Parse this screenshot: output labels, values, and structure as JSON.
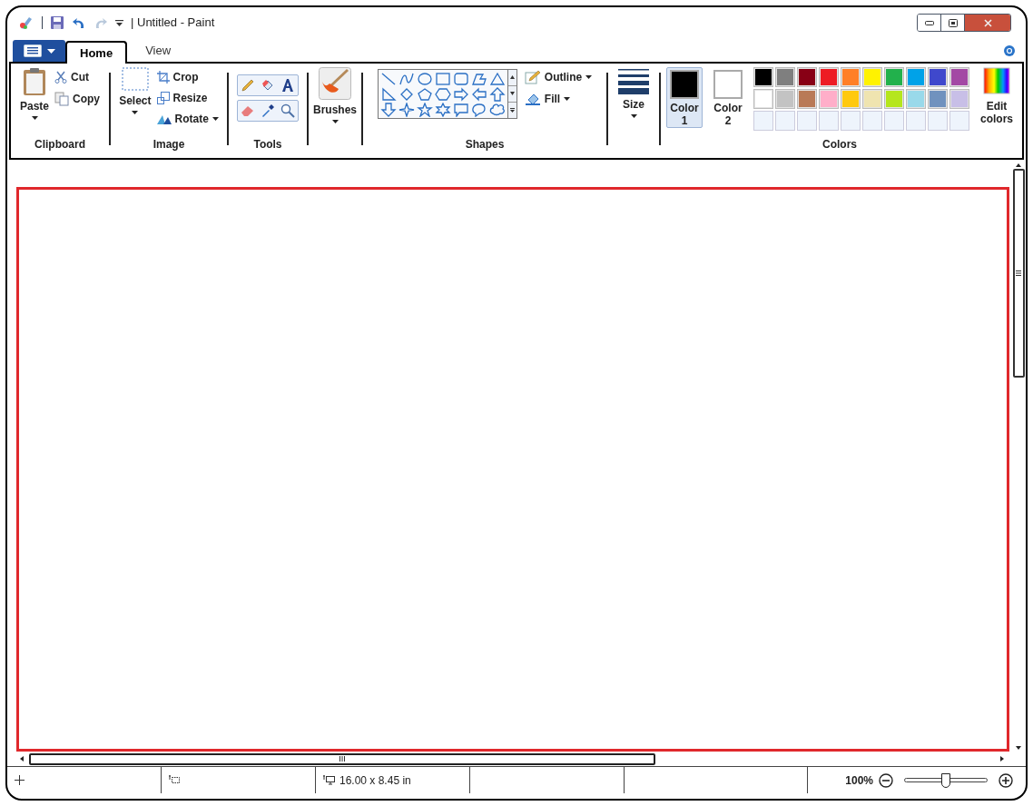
{
  "window": {
    "title": "| Untitled - Paint"
  },
  "tabs": [
    {
      "label": "Home",
      "selected": true
    },
    {
      "label": "View",
      "selected": false
    }
  ],
  "ribbon": {
    "clipboard": {
      "paste": "Paste",
      "cut": "Cut",
      "copy": "Copy",
      "label": "Clipboard"
    },
    "image": {
      "select": "Select",
      "crop": "Crop",
      "resize": "Resize",
      "rotate": "Rotate",
      "label": "Image"
    },
    "tools": {
      "label": "Tools"
    },
    "brushes": {
      "label": "Brushes"
    },
    "shapes": {
      "outline": "Outline",
      "fill": "Fill",
      "label": "Shapes"
    },
    "size": {
      "label": "Size"
    },
    "colors": {
      "color1": {
        "label": "Color",
        "number": "1",
        "color": "#000000",
        "selected": true
      },
      "color2": {
        "label": "Color",
        "number": "2",
        "color": "#ffffff",
        "selected": false
      },
      "palette": [
        {
          "color": "#000000"
        },
        {
          "color": "#7f7f7f"
        },
        {
          "color": "#880015"
        },
        {
          "color": "#ed1c24"
        },
        {
          "color": "#ff7f27"
        },
        {
          "color": "#fff200"
        },
        {
          "color": "#22b14c"
        },
        {
          "color": "#00a2e8"
        },
        {
          "color": "#3f48cc"
        },
        {
          "color": "#a349a4"
        },
        {
          "color": "#ffffff"
        },
        {
          "color": "#c3c3c3"
        },
        {
          "color": "#b97a57"
        },
        {
          "color": "#ffaec9"
        },
        {
          "color": "#ffc90e"
        },
        {
          "color": "#efe4b0"
        },
        {
          "color": "#b5e61d"
        },
        {
          "color": "#99d9ea"
        },
        {
          "color": "#7092be"
        },
        {
          "color": "#c8bfe7"
        }
      ],
      "edit": "Edit colors",
      "label": "Colors"
    }
  },
  "status_bar": {
    "dimensions": "16.00 x 8.45 in",
    "zoom": "100%",
    "zoom_level": {
      "level": 0.5
    }
  }
}
